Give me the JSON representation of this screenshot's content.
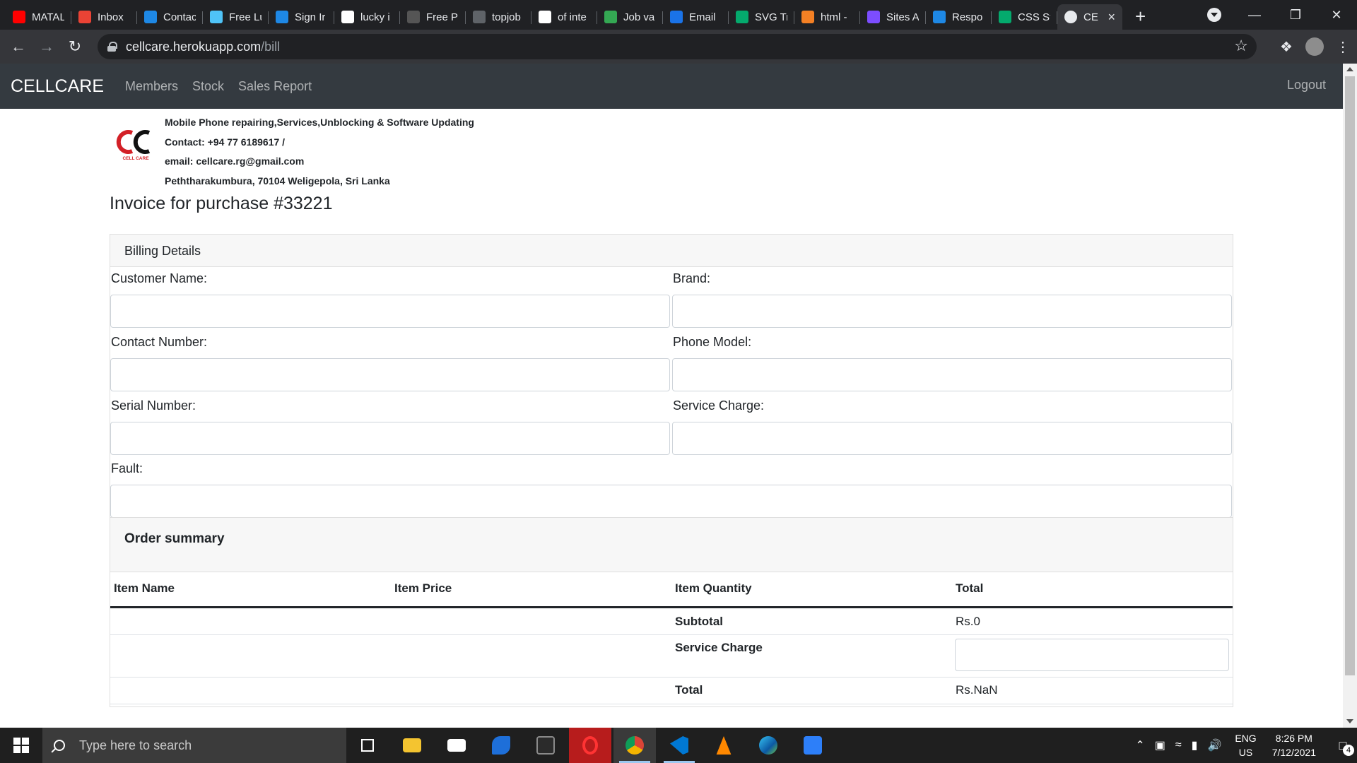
{
  "browser": {
    "tabs": [
      {
        "label": "MATAL",
        "icon": "youtube-icon",
        "color": "#ff0000"
      },
      {
        "label": "Inbox",
        "icon": "gmail-icon",
        "color": "#ea4335"
      },
      {
        "label": "Contac",
        "icon": "x3-icon",
        "color": "#1e88e5"
      },
      {
        "label": "Free Lu",
        "icon": "scribble-icon",
        "color": "#4fc3f7"
      },
      {
        "label": "Sign Ir",
        "icon": "x3-icon",
        "color": "#1e88e5"
      },
      {
        "label": "lucky i",
        "icon": "google-icon",
        "color": "#ffffff"
      },
      {
        "label": "Free Pi",
        "icon": "m-icon",
        "color": "#555555"
      },
      {
        "label": "topjob",
        "icon": "globe-icon",
        "color": "#5f6368"
      },
      {
        "label": "of inte",
        "icon": "google-icon",
        "color": "#ffffff"
      },
      {
        "label": "Job va",
        "icon": "loop-icon",
        "color": "#34a853"
      },
      {
        "label": "Email",
        "icon": "info-icon",
        "color": "#1a73e8"
      },
      {
        "label": "SVG Tr",
        "icon": "w3-icon",
        "color": "#04aa6d"
      },
      {
        "label": "html -",
        "icon": "stackoverflow-icon",
        "color": "#f48024"
      },
      {
        "label": "Sites A",
        "icon": "m-icon",
        "color": "#7c4dff"
      },
      {
        "label": "Respo",
        "icon": "cn-icon",
        "color": "#1e88e5"
      },
      {
        "label": "CSS St",
        "icon": "w3-icon",
        "color": "#04aa6d"
      }
    ],
    "active_tab": {
      "label": "CE",
      "close": "×"
    },
    "new_tab": "+",
    "url_host": "cellcare.herokuapp.com",
    "url_path": "/bill"
  },
  "app": {
    "brand": "CELLCARE",
    "nav": [
      "Members",
      "Stock",
      "Sales Report"
    ],
    "logout": "Logout",
    "logo_text": "CELL CARE",
    "company_lines": [
      "Mobile Phone repairing,Services,Unblocking & Software Updating",
      "Contact: +94 77 6189617 /",
      "email: cellcare.rg@gmail.com",
      "Peththarakumbura, 70104 Weligepola, Sri Lanka"
    ],
    "invoice_title": "Invoice for purchase #33221",
    "billing_header": "Billing Details",
    "labels": {
      "customer_name": "Customer Name:",
      "brand": "Brand:",
      "contact_number": "Contact Number:",
      "phone_model": "Phone Model:",
      "serial_number": "Serial Number:",
      "service_charge": "Service Charge:",
      "fault": "Fault:"
    },
    "values": {
      "customer_name": "",
      "brand": "",
      "contact_number": "",
      "phone_model": "",
      "serial_number": "",
      "service_charge": "",
      "fault": ""
    },
    "summary_header": "Order summary",
    "table_headers": [
      "Item Name",
      "Item Price",
      "Item Quantity",
      "Total"
    ],
    "subtotal_label": "Subtotal",
    "subtotal_value": "Rs.0",
    "service_charge_label": "Service Charge",
    "service_charge_value": "",
    "total_label": "Total",
    "total_value": "Rs.NaN"
  },
  "taskbar": {
    "search_placeholder": "Type here to search",
    "lang_top": "ENG",
    "lang_bottom": "US",
    "time": "8:26 PM",
    "date": "7/12/2021",
    "notification_count": "4"
  }
}
